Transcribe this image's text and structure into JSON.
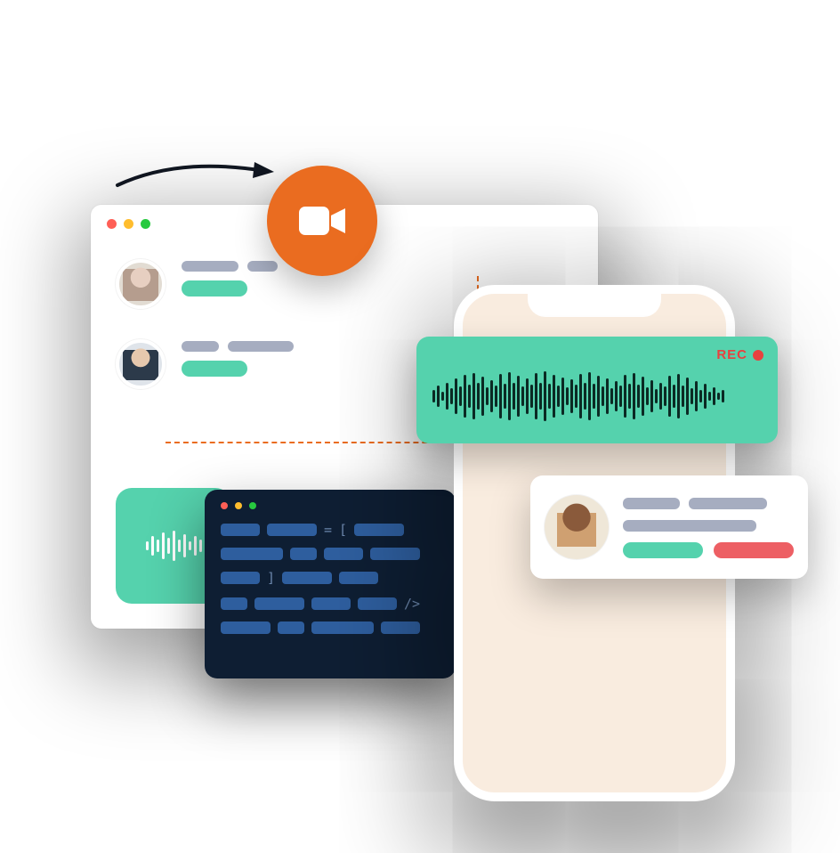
{
  "recording": {
    "label": "REC"
  },
  "colors": {
    "teal": "#55d2ad",
    "orange": "#ea6c20",
    "navy": "#0e1e33",
    "sand": "#f9ecdf",
    "red": "#e8413f",
    "grey": "#a6adc0"
  },
  "icons": {
    "video": "video-camera-icon",
    "waveform": "waveform-icon",
    "arrow": "arrow-right-icon"
  },
  "waveform_heights": [
    14,
    24,
    10,
    30,
    18,
    40,
    22,
    48,
    26,
    52,
    30,
    44,
    20,
    36,
    24,
    50,
    28,
    54,
    30,
    46,
    22,
    40,
    26,
    52,
    30,
    56,
    28,
    48,
    24,
    42,
    20,
    38,
    26,
    50,
    30,
    54,
    28,
    46,
    22,
    40,
    18,
    34,
    24,
    48,
    28,
    52,
    26,
    44,
    20,
    36,
    16,
    30,
    22,
    46,
    26,
    50,
    24,
    42,
    18,
    34,
    14,
    28,
    10,
    20,
    8,
    14
  ],
  "mini_waveform_heights": [
    10,
    22,
    14,
    30,
    18,
    34,
    14,
    26,
    10,
    22,
    14
  ]
}
